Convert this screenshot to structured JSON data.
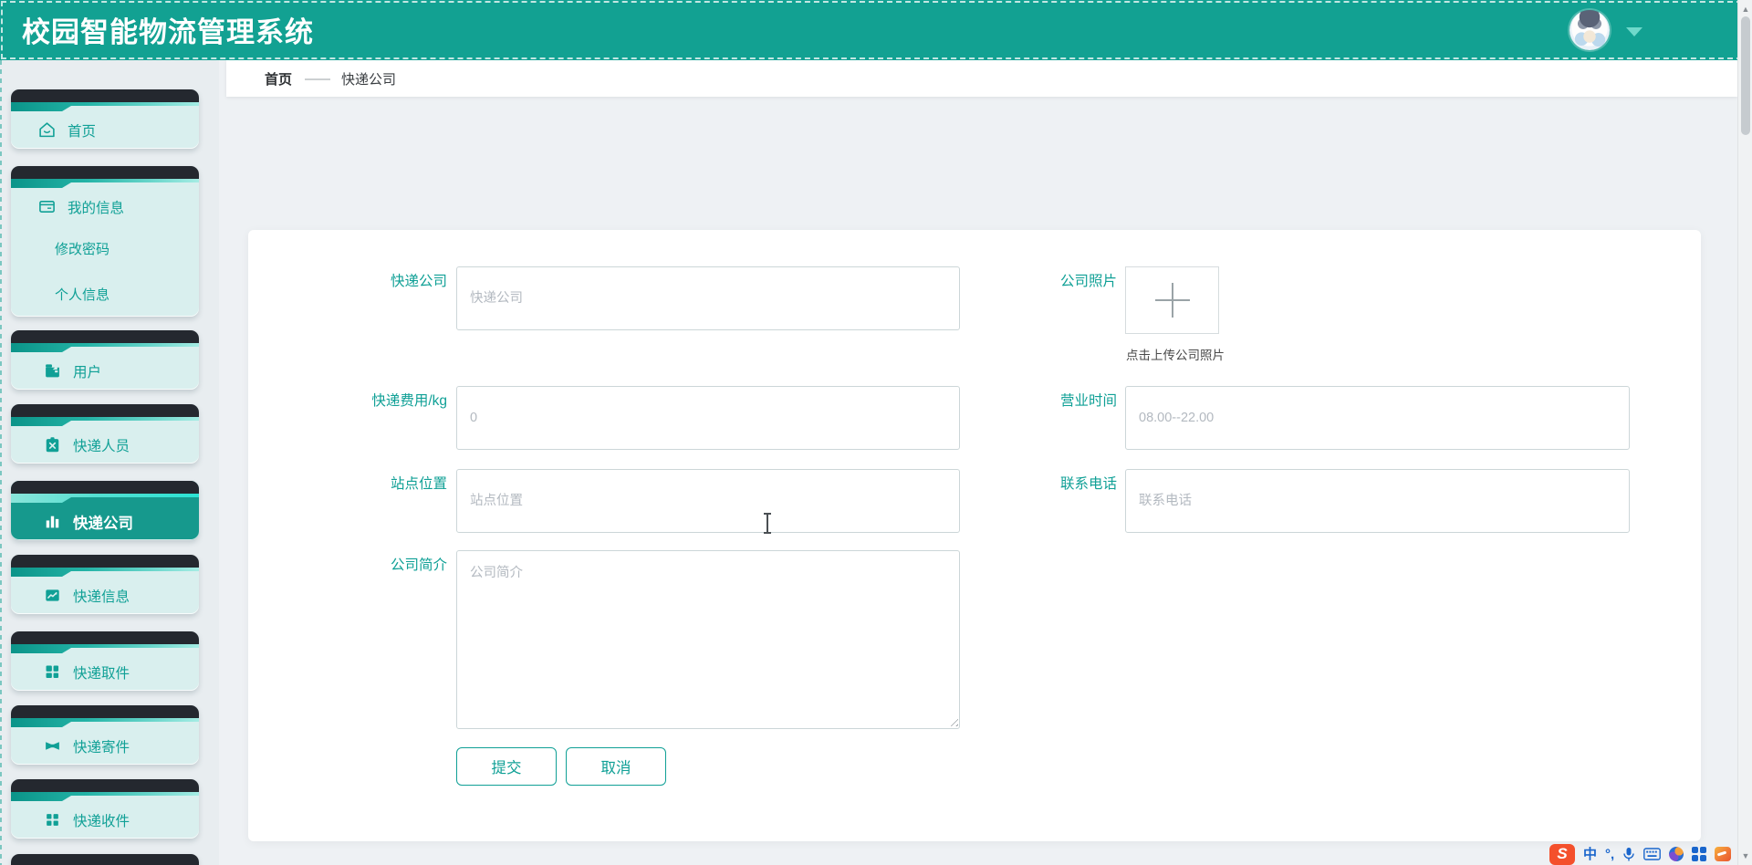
{
  "app": {
    "title": "校园智能物流管理系统"
  },
  "breadcrumb": {
    "home": "首页",
    "separator": "——",
    "current": "快递公司"
  },
  "sidebar": {
    "items": [
      {
        "label": "首页",
        "icon": "home-icon",
        "active": false
      },
      {
        "label": "我的信息",
        "icon": "id-card-icon",
        "active": false,
        "children": [
          "修改密码",
          "个人信息"
        ]
      },
      {
        "label": "用户",
        "icon": "briefcase-icon",
        "active": false
      },
      {
        "label": "快递人员",
        "icon": "clipboard-x-icon",
        "active": false
      },
      {
        "label": "快递公司",
        "icon": "bar-chart-icon",
        "active": true
      },
      {
        "label": "快递信息",
        "icon": "trend-chart-icon",
        "active": false
      },
      {
        "label": "快递取件",
        "icon": "grid-icon",
        "active": false
      },
      {
        "label": "快递寄件",
        "icon": "bowtie-icon",
        "active": false
      },
      {
        "label": "快递收件",
        "icon": "grid-small-icon",
        "active": false
      }
    ]
  },
  "form": {
    "company": {
      "label": "快递公司",
      "placeholder": "快递公司"
    },
    "photo": {
      "label": "公司照片",
      "hint": "点击上传公司照片"
    },
    "fee": {
      "label": "快递费用/kg",
      "placeholder": "0"
    },
    "hours": {
      "label": "营业时间",
      "placeholder": "08.00--22.00"
    },
    "location": {
      "label": "站点位置",
      "placeholder": "站点位置"
    },
    "phone": {
      "label": "联系电话",
      "placeholder": "联系电话"
    },
    "intro": {
      "label": "公司简介",
      "placeholder": "公司简介"
    },
    "buttons": {
      "submit": "提交",
      "cancel": "取消"
    }
  },
  "taskbar": {
    "sogou": "S",
    "lang": "中",
    "punct": "°,"
  },
  "colors": {
    "header_teal": "#12a192",
    "active_item": "#16998d",
    "card_mint": "#d9efee",
    "dark_bar": "#24282f",
    "label_teal": "#10a096"
  }
}
